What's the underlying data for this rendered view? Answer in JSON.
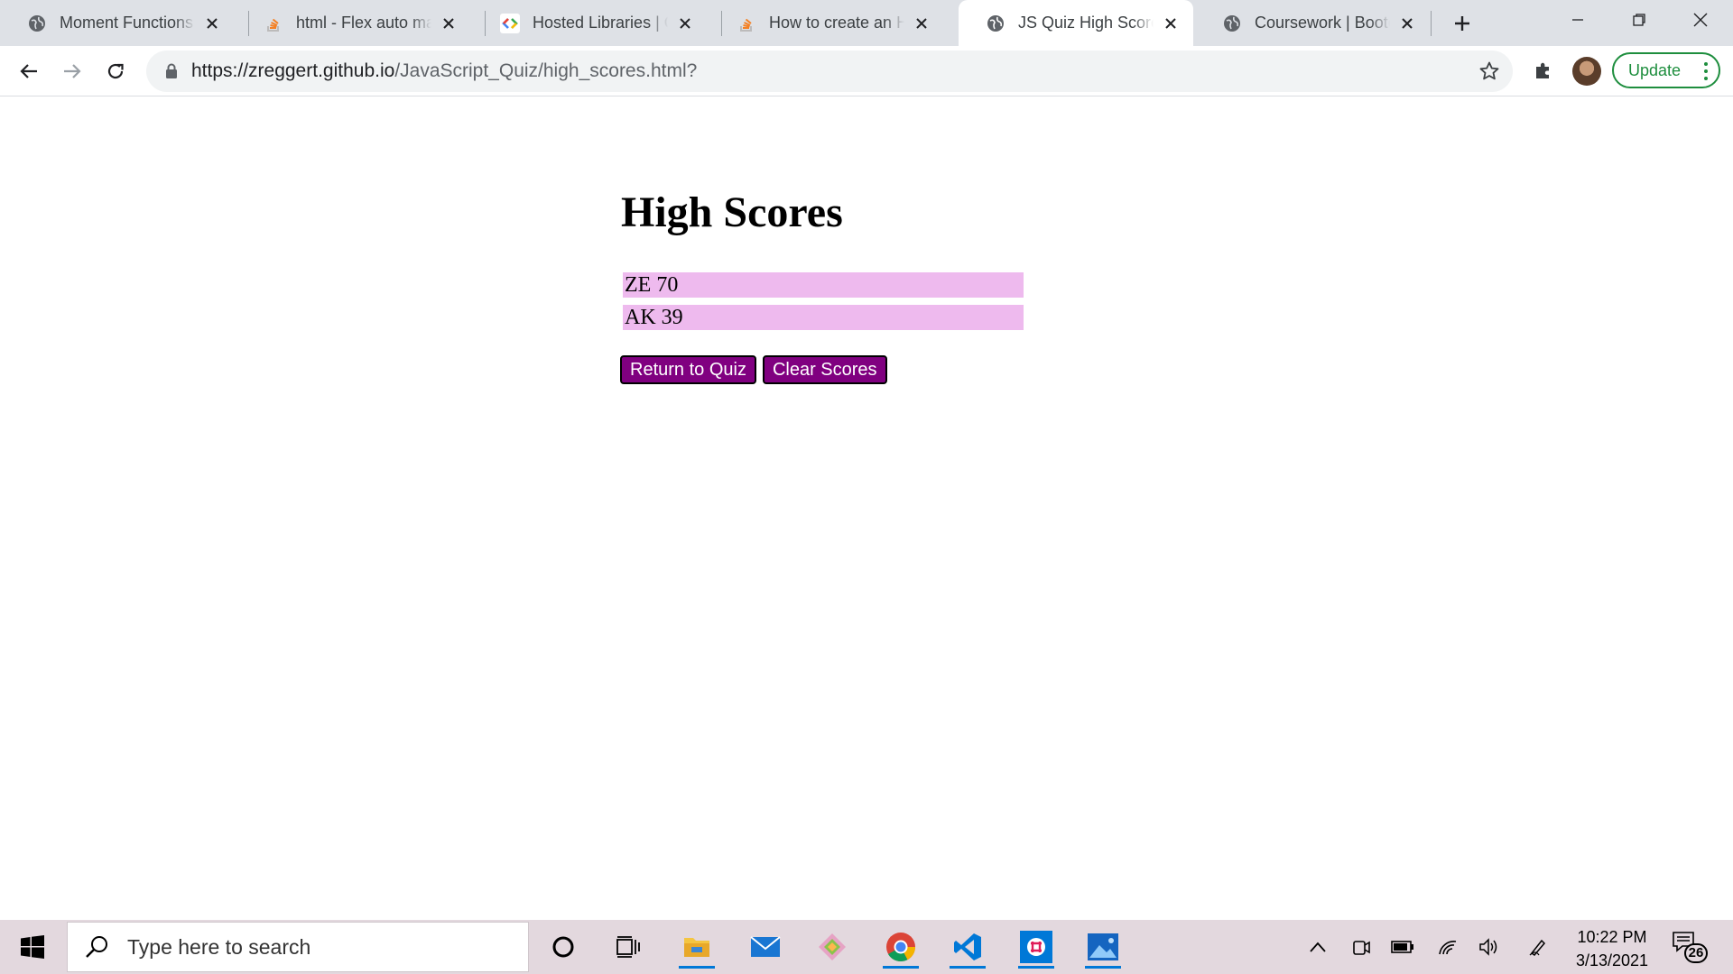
{
  "browser": {
    "tabs": [
      {
        "title": "Moment Functions",
        "icon": "globe-icon"
      },
      {
        "title": "html - Flex auto margin",
        "icon": "stackoverflow-icon"
      },
      {
        "title": "Hosted Libraries | Google",
        "icon": "google-developers-icon"
      },
      {
        "title": "How to create an HTML",
        "icon": "stackoverflow-icon"
      },
      {
        "title": "JS Quiz High Scores",
        "icon": "globe-icon",
        "active": true
      },
      {
        "title": "Coursework | Bootcamp",
        "icon": "globe-icon"
      }
    ],
    "url_host": "https://zreggert.github.io",
    "url_path": "/JavaScript_Quiz/high_scores.html?",
    "update_label": "Update"
  },
  "page": {
    "title": "High Scores",
    "scores": [
      "ZE 70",
      "AK 39"
    ],
    "return_label": "Return to Quiz",
    "clear_label": "Clear Scores"
  },
  "taskbar": {
    "search_placeholder": "Type here to search",
    "time": "10:22 PM",
    "date": "3/13/2021",
    "notification_count": "26"
  },
  "colors": {
    "button_bg": "#800080",
    "score_bg": "#eebaee",
    "update_green": "#1e8e3e"
  }
}
